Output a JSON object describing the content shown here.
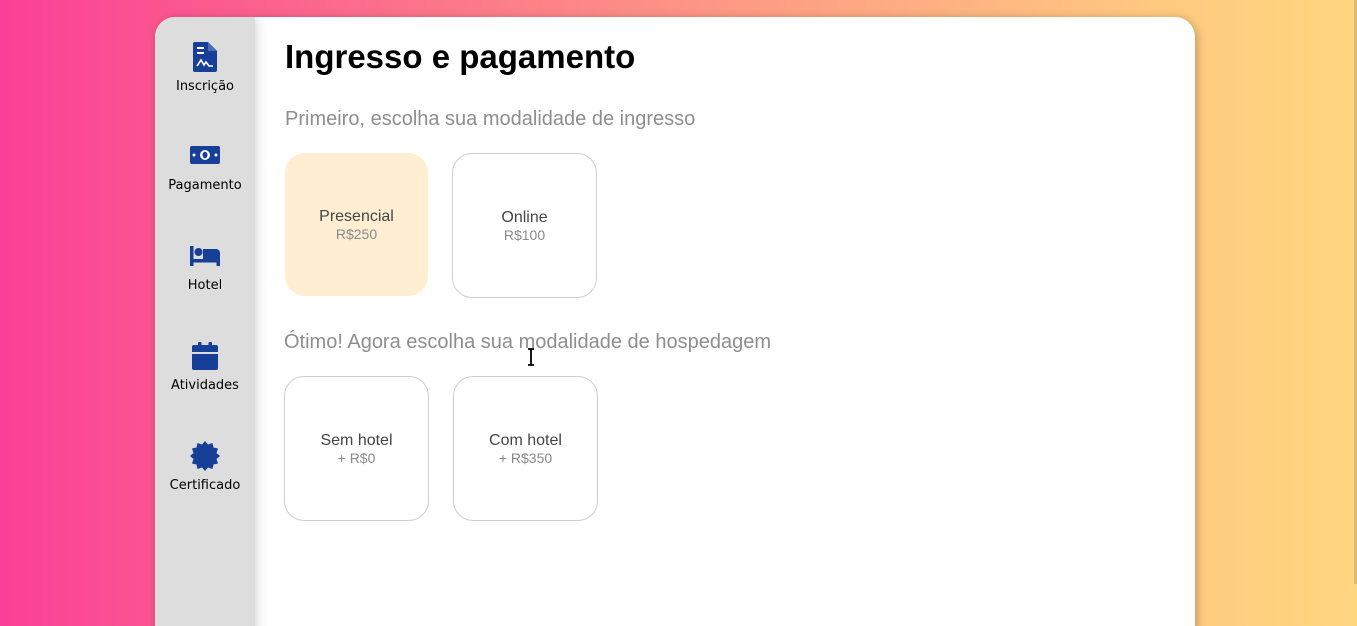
{
  "sidebar": {
    "items": [
      {
        "label": "Inscrição",
        "icon": "file-signature-icon"
      },
      {
        "label": "Pagamento",
        "icon": "money-bill-icon"
      },
      {
        "label": "Hotel",
        "icon": "bed-icon"
      },
      {
        "label": "Atividades",
        "icon": "calendar-icon"
      },
      {
        "label": "Certificado",
        "icon": "certificate-icon"
      }
    ],
    "icon_color": "#173f98"
  },
  "main": {
    "title": "Ingresso e pagamento",
    "ticket_section": {
      "subtitle": "Primeiro, escolha sua modalidade de ingresso",
      "options": [
        {
          "name": "Presencial",
          "price": "R$250",
          "selected": true
        },
        {
          "name": "Online",
          "price": "R$100",
          "selected": false
        }
      ]
    },
    "hotel_section": {
      "subtitle": "Ótimo! Agora escolha sua modalidade de hospedagem",
      "options": [
        {
          "name": "Sem hotel",
          "price": "+ R$0",
          "selected": false
        },
        {
          "name": "Com hotel",
          "price": "+ R$350",
          "selected": false
        }
      ]
    }
  },
  "colors": {
    "selected_card": "#ffeed2",
    "sidebar_bg": "#dddddd",
    "gradient_start": "#fa4098",
    "gradient_end": "#ffd77f"
  }
}
